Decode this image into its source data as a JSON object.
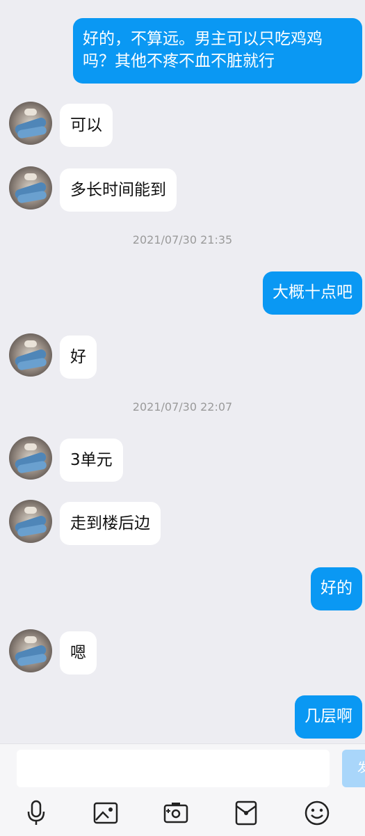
{
  "messages": [
    {
      "side": "out",
      "text": "好的，不算远。男主可以只吃鸡鸡\n吗？其他不疼不血不脏就行"
    },
    {
      "side": "in",
      "text": "可以"
    },
    {
      "side": "in",
      "text": "多长时间能到"
    },
    {
      "timestamp": "2021/07/30 21:35"
    },
    {
      "side": "out",
      "text": "大概十点吧"
    },
    {
      "side": "in",
      "text": "好"
    },
    {
      "timestamp": "2021/07/30 22:07"
    },
    {
      "side": "in",
      "text": "3单元"
    },
    {
      "side": "in",
      "text": "走到楼后边"
    },
    {
      "side": "out",
      "text": "好的"
    },
    {
      "side": "in",
      "text": "嗯"
    },
    {
      "side": "out",
      "text": "几层啊"
    }
  ],
  "composer": {
    "input_value": "",
    "send_label": "发"
  },
  "toolbar": {
    "icons": [
      "microphone-icon",
      "image-icon",
      "camera-icon",
      "red-packet-icon",
      "emoji-icon"
    ]
  },
  "colors": {
    "outgoing_bubble": "#0a98f3",
    "incoming_bubble": "#ffffff",
    "background": "#ededf2"
  }
}
